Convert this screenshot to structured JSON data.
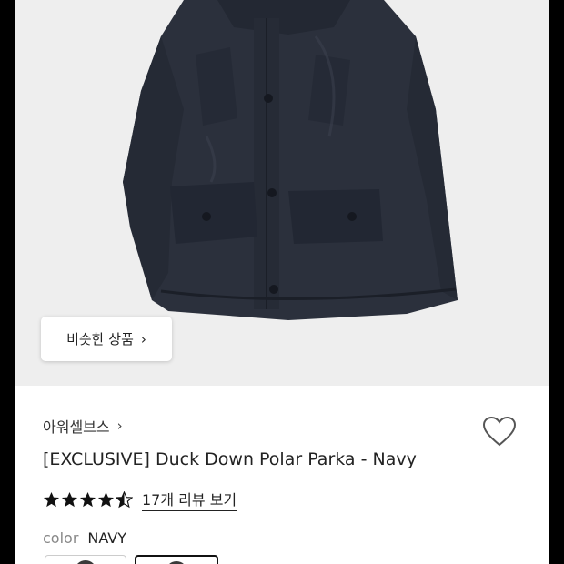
{
  "similar": {
    "label": "비슷한 상품",
    "chevron": "›"
  },
  "brand": {
    "name": "아워셀브스",
    "chevron": "›"
  },
  "product": {
    "title": "[EXCLUSIVE] Duck Down Polar Parka - Navy"
  },
  "rating": {
    "value": 4.5,
    "max": 5,
    "reviews_label": "17개 리뷰 보기"
  },
  "color": {
    "label": "color",
    "value": "NAVY"
  },
  "colors": {
    "photo_bg": "#eeeeee",
    "parka": "#2a2f3b"
  },
  "icons": [
    "heart-icon",
    "star-icon",
    "chevron-right-icon"
  ]
}
